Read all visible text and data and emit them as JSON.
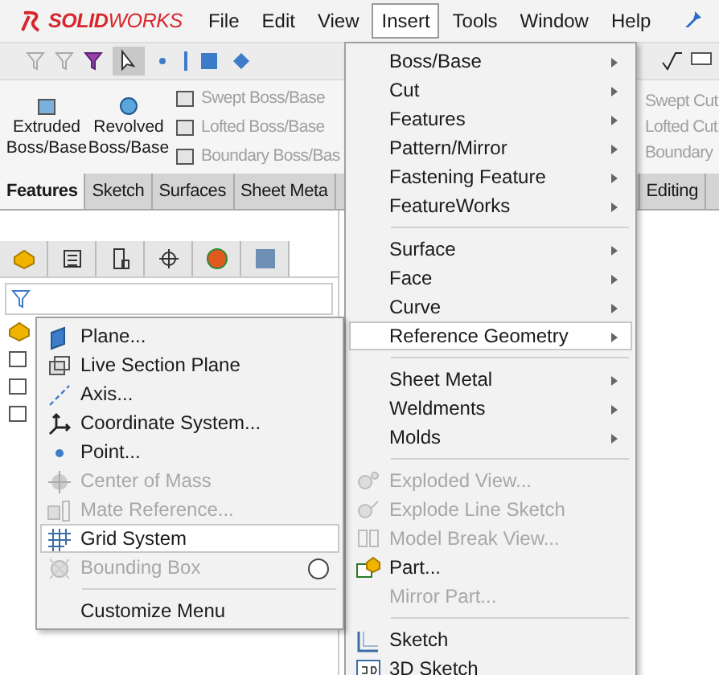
{
  "title_bar": {
    "brand": "**SOLID**WORKS",
    "menu": [
      {
        "label": "File",
        "selected": false
      },
      {
        "label": "Edit",
        "selected": false
      },
      {
        "label": "View",
        "selected": false
      },
      {
        "label": "Insert",
        "selected": true
      },
      {
        "label": "Tools",
        "selected": false
      },
      {
        "label": "Window",
        "selected": false
      },
      {
        "label": "Help",
        "selected": false
      }
    ]
  },
  "command_manager": {
    "large_buttons": [
      {
        "label": "Extruded Boss/Base"
      },
      {
        "label": "Revolved Boss/Base"
      }
    ],
    "small_buttons": [
      {
        "label": "Swept Boss/Base",
        "disabled": true
      },
      {
        "label": "Lofted Boss/Base",
        "disabled": true
      },
      {
        "label": "Boundary Boss/Bas",
        "disabled": true
      }
    ],
    "right_buttons": [
      {
        "label": "Swept Cut",
        "disabled": true
      },
      {
        "label": "Lofted Cut",
        "disabled": true
      },
      {
        "label": "Boundary",
        "disabled": true
      }
    ]
  },
  "tabs": [
    {
      "label": "Features",
      "selected": true
    },
    {
      "label": "Sketch",
      "selected": false
    },
    {
      "label": "Surfaces",
      "selected": false
    },
    {
      "label": "Sheet Meta",
      "selected": false
    },
    {
      "label": "Editing",
      "selected": false
    }
  ],
  "insert_menu": [
    {
      "kind": "item",
      "label": "Boss/Base",
      "submenu": true,
      "disabled": false,
      "selected": false
    },
    {
      "kind": "item",
      "label": "Cut",
      "submenu": true,
      "disabled": false,
      "selected": false
    },
    {
      "kind": "item",
      "label": "Features",
      "submenu": true,
      "disabled": false,
      "selected": false
    },
    {
      "kind": "item",
      "label": "Pattern/Mirror",
      "submenu": true,
      "disabled": false,
      "selected": false
    },
    {
      "kind": "item",
      "label": "Fastening Feature",
      "submenu": true,
      "disabled": false,
      "selected": false
    },
    {
      "kind": "item",
      "label": "FeatureWorks",
      "submenu": true,
      "disabled": false,
      "selected": false
    },
    {
      "kind": "separator"
    },
    {
      "kind": "item",
      "label": "Surface",
      "submenu": true,
      "disabled": false,
      "selected": false
    },
    {
      "kind": "item",
      "label": "Face",
      "submenu": true,
      "disabled": false,
      "selected": false
    },
    {
      "kind": "item",
      "label": "Curve",
      "submenu": true,
      "disabled": false,
      "selected": false
    },
    {
      "kind": "item",
      "label": "Reference Geometry",
      "submenu": true,
      "disabled": false,
      "selected": true
    },
    {
      "kind": "separator"
    },
    {
      "kind": "item",
      "label": "Sheet Metal",
      "submenu": true,
      "disabled": false,
      "selected": false
    },
    {
      "kind": "item",
      "label": "Weldments",
      "submenu": true,
      "disabled": false,
      "selected": false
    },
    {
      "kind": "item",
      "label": "Molds",
      "submenu": true,
      "disabled": false,
      "selected": false
    },
    {
      "kind": "separator"
    },
    {
      "kind": "item",
      "label": "Exploded View...",
      "submenu": false,
      "disabled": true,
      "selected": false
    },
    {
      "kind": "item",
      "label": "Explode Line Sketch",
      "submenu": false,
      "disabled": true,
      "selected": false
    },
    {
      "kind": "item",
      "label": "Model Break View...",
      "submenu": false,
      "disabled": true,
      "selected": false
    },
    {
      "kind": "item",
      "label": "Part...",
      "submenu": false,
      "disabled": false,
      "selected": false
    },
    {
      "kind": "item",
      "label": "Mirror Part...",
      "submenu": false,
      "disabled": true,
      "selected": false
    },
    {
      "kind": "separator"
    },
    {
      "kind": "item",
      "label": "Sketch",
      "submenu": false,
      "disabled": false,
      "selected": false
    },
    {
      "kind": "item",
      "label": "3D Sketch",
      "submenu": false,
      "disabled": false,
      "selected": false
    }
  ],
  "reference_geometry_menu": [
    {
      "kind": "item",
      "label": "Plane...",
      "disabled": false,
      "selected": false
    },
    {
      "kind": "item",
      "label": "Live Section Plane",
      "disabled": false,
      "selected": false
    },
    {
      "kind": "item",
      "label": "Axis...",
      "disabled": false,
      "selected": false
    },
    {
      "kind": "item",
      "label": "Coordinate System...",
      "disabled": false,
      "selected": false
    },
    {
      "kind": "item",
      "label": "Point...",
      "disabled": false,
      "selected": false
    },
    {
      "kind": "item",
      "label": "Center of Mass",
      "disabled": true,
      "selected": false
    },
    {
      "kind": "item",
      "label": "Mate Reference...",
      "disabled": true,
      "selected": false
    },
    {
      "kind": "item",
      "label": "Grid System",
      "disabled": false,
      "selected": true
    },
    {
      "kind": "item",
      "label": "Bounding Box",
      "disabled": true,
      "selected": false
    },
    {
      "kind": "separator"
    },
    {
      "kind": "item",
      "label": "Customize Menu",
      "disabled": false,
      "selected": false
    }
  ]
}
